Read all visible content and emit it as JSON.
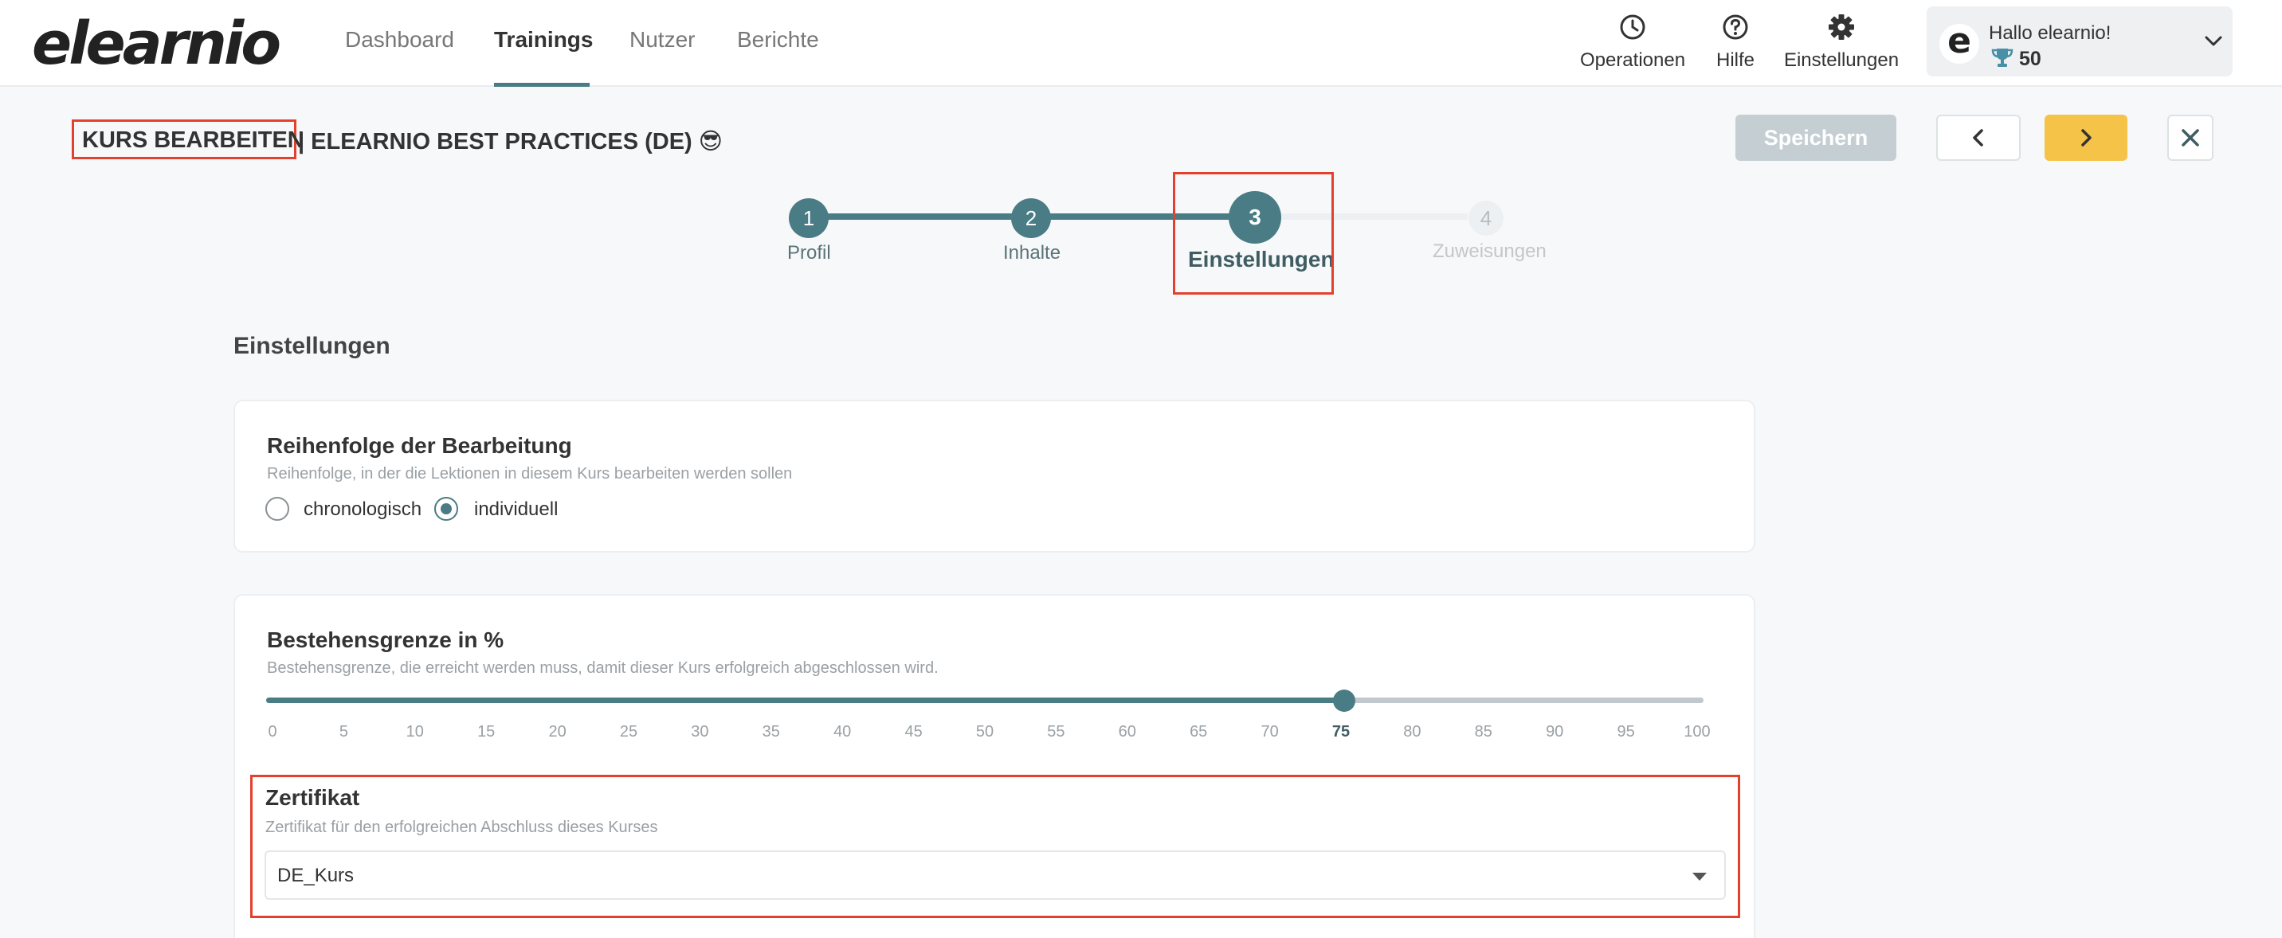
{
  "header": {
    "logo": "elearnio",
    "nav": [
      {
        "label": "Dashboard",
        "active": false
      },
      {
        "label": "Trainings",
        "active": true
      },
      {
        "label": "Nutzer",
        "active": false
      },
      {
        "label": "Berichte",
        "active": false
      }
    ],
    "tools": {
      "operations": "Operationen",
      "help": "Hilfe",
      "settings": "Einstellungen"
    },
    "user": {
      "avatar_letter": "e",
      "greeting": "Hallo elearnio!",
      "points": "50"
    }
  },
  "title": {
    "prefix": "KURS BEARBEITEN",
    "rest": "| ELEARNIO BEST PRACTICES (DE) 😎"
  },
  "actions": {
    "save_label": "Speichern"
  },
  "stepper": {
    "current": 3,
    "steps": [
      {
        "number": "1",
        "label": "Profil"
      },
      {
        "number": "2",
        "label": "Inhalte"
      },
      {
        "number": "3",
        "label": "Einstellungen"
      },
      {
        "number": "4",
        "label": "Zuweisungen"
      }
    ]
  },
  "section_title": "Einstellungen",
  "order_card": {
    "title": "Reihenfolge der Bearbeitung",
    "subtitle": "Reihenfolge, in der die Lektionen in diesem Kurs bearbeiten werden sollen",
    "options": [
      {
        "label": "chronologisch",
        "checked": false
      },
      {
        "label": "individuell",
        "checked": true
      }
    ]
  },
  "threshold_card": {
    "title": "Bestehensgrenze in %",
    "subtitle": "Bestehensgrenze, die erreicht werden muss, damit dieser Kurs erfolgreich abgeschlossen wird.",
    "value": 75,
    "min": 0,
    "max": 100,
    "ticks": [
      "0",
      "5",
      "10",
      "15",
      "20",
      "25",
      "30",
      "35",
      "40",
      "45",
      "50",
      "55",
      "60",
      "65",
      "70",
      "75",
      "80",
      "85",
      "90",
      "95",
      "100"
    ]
  },
  "certificate": {
    "title": "Zertifikat",
    "subtitle": "Zertifikat für den erfolgreichen Abschluss dieses Kurses",
    "selected": "DE_Kurs"
  },
  "colors": {
    "accent": "#4a7c85",
    "next_button": "#f5c347",
    "highlight": "#e2412d",
    "save_disabled": "#c5ced2"
  }
}
